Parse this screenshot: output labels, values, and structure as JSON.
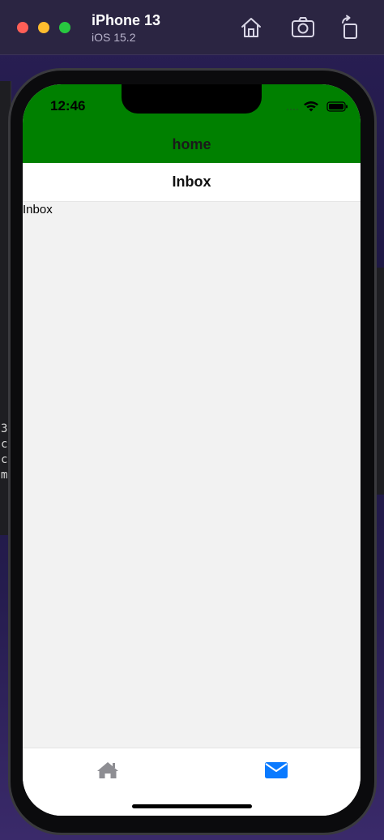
{
  "simulator": {
    "device_name": "iPhone 13",
    "os_version": "iOS 15.2",
    "icons": [
      "home-icon",
      "screenshot-icon",
      "rotate-icon"
    ]
  },
  "status_bar": {
    "time": "12:46",
    "icons": [
      "wifi-icon",
      "battery-icon"
    ]
  },
  "header": {
    "title": "home",
    "background": "#008000"
  },
  "navbar": {
    "title": "Inbox"
  },
  "content": {
    "text": "Inbox"
  },
  "tabbar": {
    "tabs": [
      {
        "icon": "home-icon",
        "active": false,
        "color": "#8e8e93"
      },
      {
        "icon": "envelope-icon",
        "active": true,
        "color": "#0a7aff"
      }
    ]
  },
  "background_window": {
    "text_fragments": [
      "3",
      "c",
      "c",
      "m"
    ]
  }
}
